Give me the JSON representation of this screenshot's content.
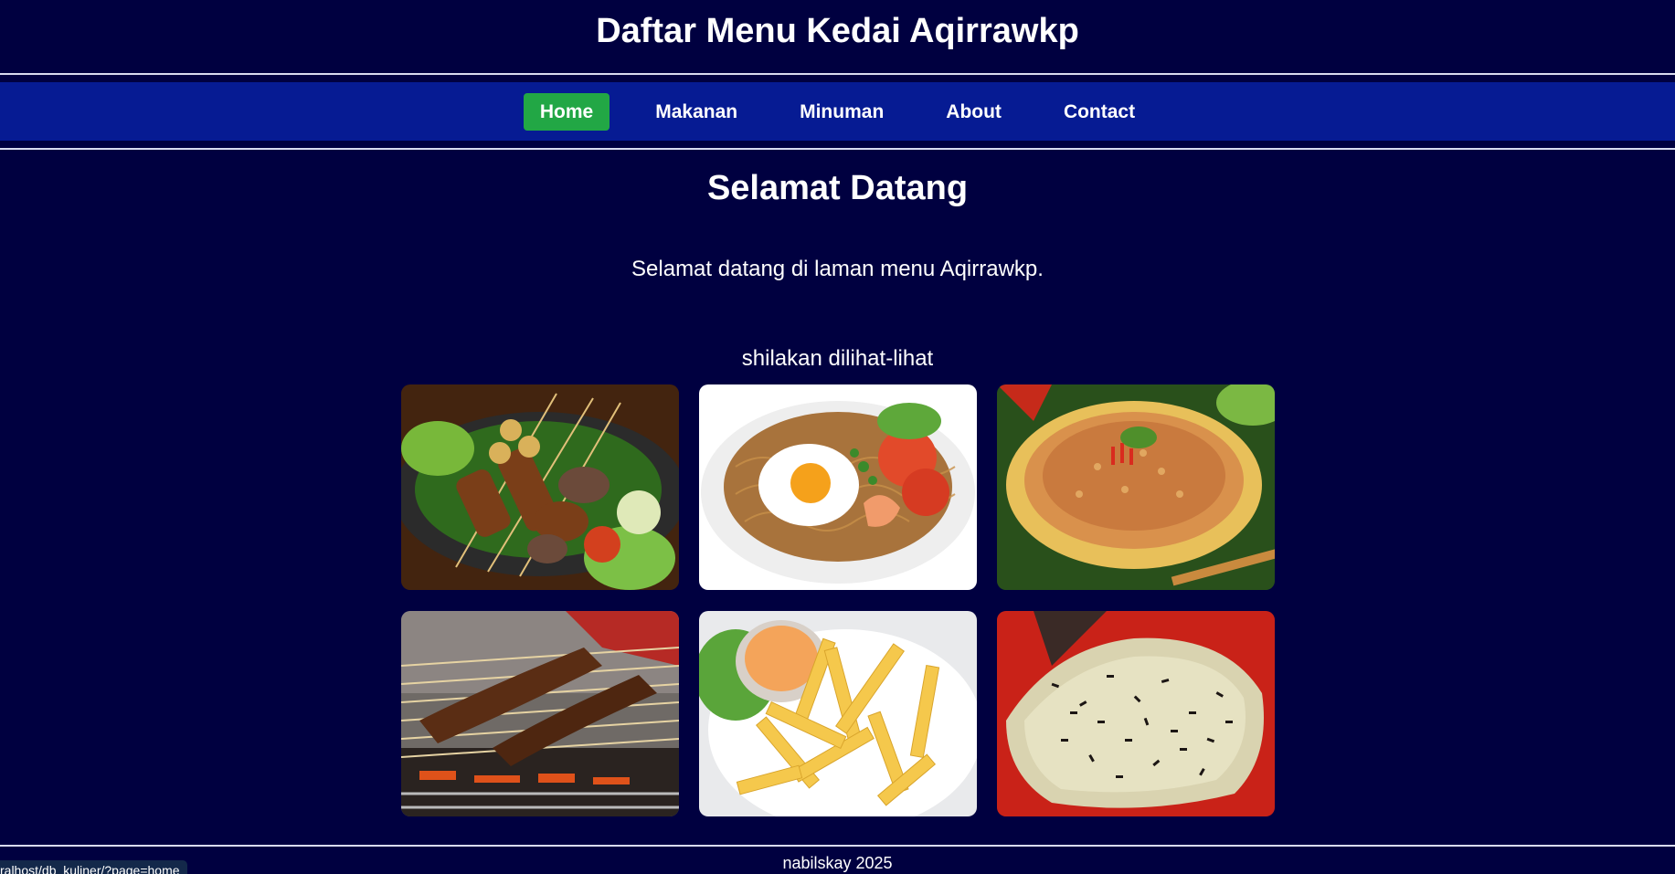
{
  "header": {
    "title": "Daftar Menu Kedai Aqirrawkp"
  },
  "nav": {
    "items": [
      {
        "label": "Home",
        "active": true
      },
      {
        "label": "Makanan",
        "active": false
      },
      {
        "label": "Minuman",
        "active": false
      },
      {
        "label": "About",
        "active": false
      },
      {
        "label": "Contact",
        "active": false
      }
    ],
    "active_color": "#22a745",
    "bar_color": "#061b93"
  },
  "main": {
    "title": "Selamat Datang",
    "intro": "Selamat datang di laman menu Aqirrawkp.",
    "browse": "shilakan dilihat-lihat"
  },
  "gallery": [
    {
      "name": "food-photo-sate-platter"
    },
    {
      "name": "food-photo-fried-noodles-egg"
    },
    {
      "name": "food-photo-martabak"
    },
    {
      "name": "food-photo-sate-grill"
    },
    {
      "name": "food-photo-french-fries"
    },
    {
      "name": "food-photo-roti-bakar"
    }
  ],
  "footer": {
    "text": "nabilskay 2025"
  },
  "status_bar": {
    "url": "ralhost/db_kuliner/?page=home"
  },
  "colors": {
    "background": "#000040"
  }
}
